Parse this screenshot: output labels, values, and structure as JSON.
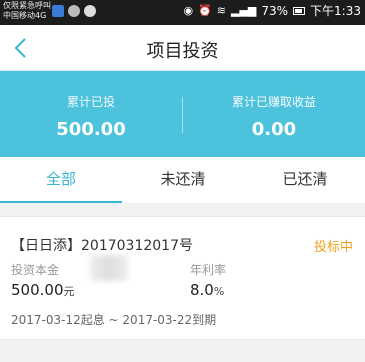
{
  "status_bar": {
    "carrier_line1": "仅限紧急呼叫",
    "carrier_line2": "中国移动4G",
    "network": "4G",
    "battery": "73%",
    "time": "下午1:33"
  },
  "nav": {
    "title": "项目投资"
  },
  "summary": {
    "invested_label": "累计已投",
    "invested_value": "500.00",
    "earned_label": "累计已赚取收益",
    "earned_value": "0.00"
  },
  "tabs": [
    {
      "label": "全部",
      "active": true
    },
    {
      "label": "未还清",
      "active": false
    },
    {
      "label": "已还清",
      "active": false
    }
  ],
  "card": {
    "title": "【日日添】20170312017号",
    "status": "投标中",
    "principal_label": "投资本金",
    "rate_label": "年利率",
    "principal_value": "500.00",
    "principal_unit": "元",
    "rate_value": "8.0",
    "rate_unit": "%",
    "dates": "2017-03-12起息 ~ 2017-03-22到期"
  },
  "colors": {
    "accent": "#37b5d4",
    "summary_bg": "#4cc2dd",
    "status_orange": "#f0a020"
  }
}
